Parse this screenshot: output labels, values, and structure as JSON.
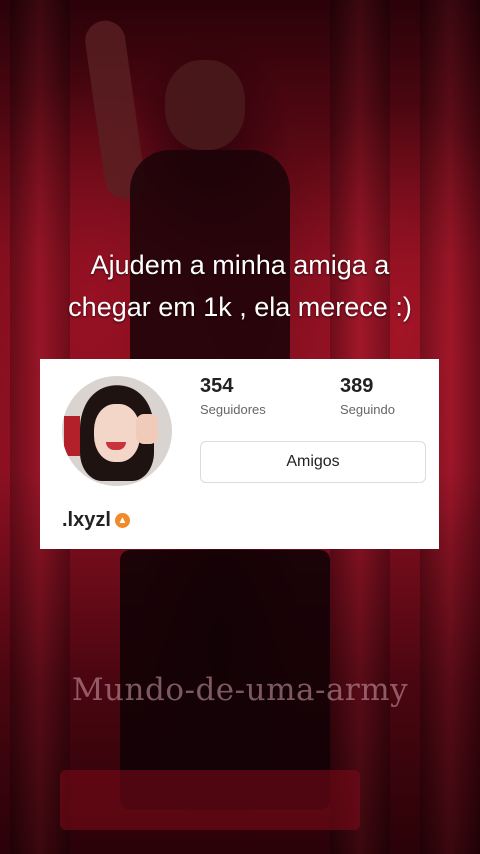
{
  "caption": {
    "line1": "Ajudem a minha amiga a",
    "line2": "chegar em 1k , ela merece :)"
  },
  "profile": {
    "followers_count": "354",
    "followers_label": "Seguidores",
    "following_count": "389",
    "following_label": "Seguindo",
    "friends_button": "Amigos",
    "username": ".lxyzl",
    "badge_icon": "level-badge-icon",
    "badge_color": "#f08a2a"
  },
  "watermark": "Mundo-de-uma-army"
}
